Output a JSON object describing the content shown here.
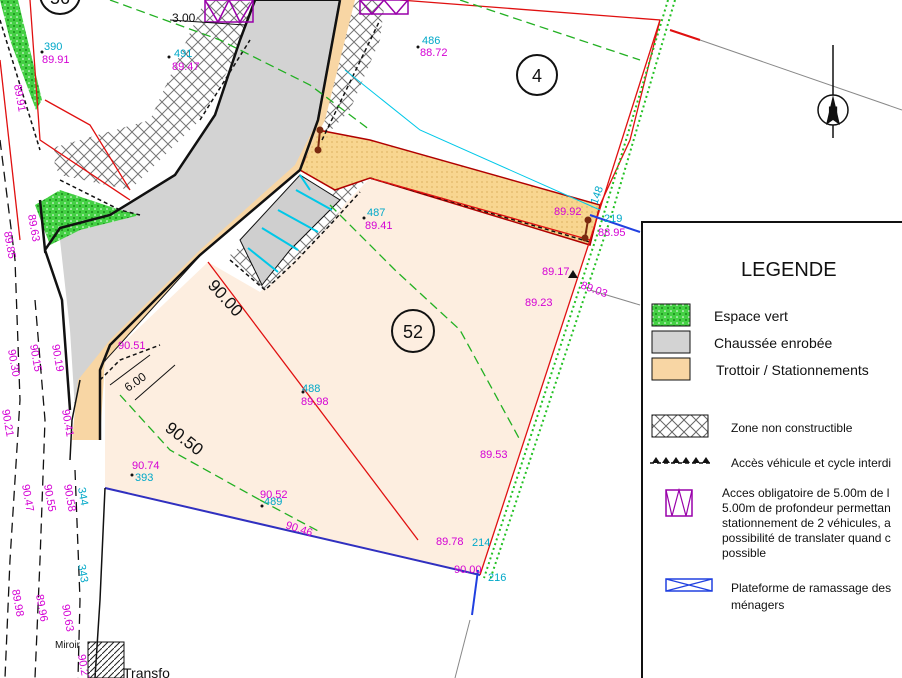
{
  "lots": {
    "main": "52",
    "neighbor": "4",
    "top_left_partial": "56"
  },
  "dimensions": {
    "d1": "3.00",
    "d2": "6.00",
    "contour_90": "90.00",
    "contour_9050": "90.50"
  },
  "points": [
    {
      "id": "390",
      "alt": "89.91"
    },
    {
      "id": "491",
      "alt": "89.47"
    },
    {
      "id": "486",
      "alt": "88.72"
    },
    {
      "id": "487",
      "alt": "89.41"
    },
    {
      "id": "488",
      "alt": "89.98"
    },
    {
      "id": "489",
      "alt": "90.52"
    },
    {
      "id": "393",
      "alt": "90.74"
    }
  ],
  "altitudes": {
    "a1": "89.92",
    "a2": "88.95",
    "a3": "89.17",
    "a4": "89.23",
    "a5": "89.03",
    "a6": "89.53",
    "a7": "89.78",
    "a8": "90.00",
    "a9": "90.46",
    "a10": "90.51",
    "id214": "214",
    "id216": "216",
    "id219": "219",
    "id148": "148"
  },
  "left_labels": [
    "89.91",
    "89.63",
    "89.85",
    "90.15",
    "90.19",
    "90.30",
    "90.41",
    "90.21",
    "90.47",
    "90.55",
    "90.58",
    "343",
    "344",
    "89.98",
    "89.96",
    "90.63",
    "90.27"
  ],
  "labels": {
    "miroir": "Miroir",
    "transfo": "Transfo",
    "north": "N"
  },
  "legend": {
    "title": "LEGENDE",
    "items": [
      {
        "label": "Espace vert",
        "swatch": "#3fd33f"
      },
      {
        "label": "Chaussée enrobée",
        "swatch": "#d3d3d3"
      },
      {
        "label": "Trottoir / Stationnements",
        "swatch": "#f8d6a4"
      },
      {
        "label": "Zone non constructible"
      },
      {
        "label": "Accès véhicule et cycle interdi"
      },
      {
        "label": "Acces obligatoire de 5.00m de l",
        "lines": [
          "5.00m de profondeur permettan",
          "stationnement de 2 véhicules, a",
          "possibilité de translater quand c",
          "possible"
        ]
      },
      {
        "label": "Plateforme de ramassage des",
        "lines": [
          "ménagers"
        ]
      }
    ]
  },
  "colors": {
    "lot_fill": "#fdeee0",
    "road": "#d3d3d3",
    "sidewalk": "#f8d6a4",
    "green": "#3fd33f",
    "magenta": "#d400d4",
    "cyan": "#00c8e8",
    "red": "#e01010"
  }
}
